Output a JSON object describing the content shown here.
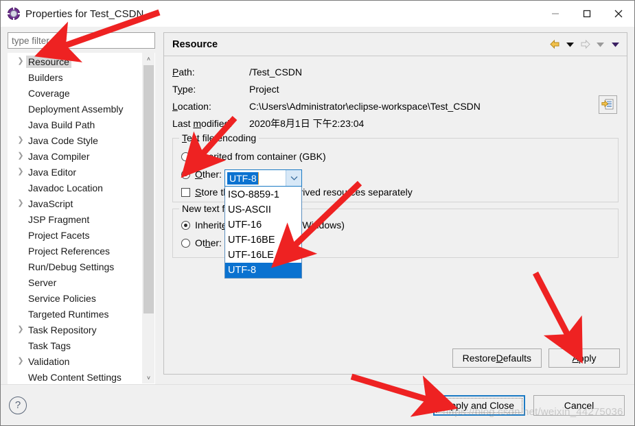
{
  "window": {
    "title": "Properties for Test_CSDN",
    "icon": "eclipse-properties-icon",
    "minimize_label": "—",
    "maximize_label": "□",
    "close_label": "✕"
  },
  "filter": {
    "placeholder": "type filter text",
    "value": ""
  },
  "tree": {
    "items": [
      {
        "label": "Resource",
        "expandable": true,
        "selected": true
      },
      {
        "label": "Builders",
        "expandable": false,
        "selected": false
      },
      {
        "label": "Coverage",
        "expandable": false,
        "selected": false
      },
      {
        "label": "Deployment Assembly",
        "expandable": false,
        "selected": false
      },
      {
        "label": "Java Build Path",
        "expandable": false,
        "selected": false
      },
      {
        "label": "Java Code Style",
        "expandable": true,
        "selected": false
      },
      {
        "label": "Java Compiler",
        "expandable": true,
        "selected": false
      },
      {
        "label": "Java Editor",
        "expandable": true,
        "selected": false
      },
      {
        "label": "Javadoc Location",
        "expandable": false,
        "selected": false
      },
      {
        "label": "JavaScript",
        "expandable": true,
        "selected": false
      },
      {
        "label": "JSP Fragment",
        "expandable": false,
        "selected": false
      },
      {
        "label": "Project Facets",
        "expandable": false,
        "selected": false
      },
      {
        "label": "Project References",
        "expandable": false,
        "selected": false
      },
      {
        "label": "Run/Debug Settings",
        "expandable": false,
        "selected": false
      },
      {
        "label": "Server",
        "expandable": false,
        "selected": false
      },
      {
        "label": "Service Policies",
        "expandable": false,
        "selected": false
      },
      {
        "label": "Targeted Runtimes",
        "expandable": false,
        "selected": false
      },
      {
        "label": "Task Repository",
        "expandable": true,
        "selected": false
      },
      {
        "label": "Task Tags",
        "expandable": false,
        "selected": false
      },
      {
        "label": "Validation",
        "expandable": true,
        "selected": false
      },
      {
        "label": "Web Content Settings",
        "expandable": false,
        "selected": false
      }
    ],
    "scroll_up_glyph": "˄",
    "scroll_down_glyph": "˅"
  },
  "pane": {
    "title": "Resource",
    "nav": {
      "back_icon": "back-arrow-icon",
      "back_menu_icon": "chevron-down-icon",
      "forward_icon": "forward-arrow-icon",
      "forward_menu_icon": "chevron-down-icon",
      "view_menu_icon": "chevron-down-icon"
    }
  },
  "properties": {
    "path_label": "Path:",
    "path_mnemonic": "P",
    "path_value": "/Test_CSDN",
    "type_label": "Type:",
    "type_mnemonic": "y",
    "type_value": "Project",
    "location_label": "Location:",
    "location_mnemonic": "L",
    "location_value": "C:\\Users\\Administrator\\eclipse-workspace\\Test_CSDN",
    "location_button_icon": "browse-folder-icon",
    "modified_label_pre": "Last ",
    "modified_mnemonic": "m",
    "modified_label_post": "odified:",
    "modified_value": "2020年8月1日 下午2:23:04"
  },
  "encoding_group": {
    "legend_pre": "T",
    "legend_post": "ext file encoding",
    "inherited_pre": "I",
    "inherited_post": "nherited from container (GBK)",
    "inherited_selected": false,
    "other_pre": "O",
    "other_post": "ther:",
    "other_selected": true,
    "store_pre": "S",
    "store_post": "tore the encoding of derived resources separately",
    "store_checked": false
  },
  "combo": {
    "value": "UTF-8",
    "arrow_icon": "chevron-down-icon",
    "open": true,
    "options": [
      {
        "label": "ISO-8859-1",
        "selected": false
      },
      {
        "label": "US-ASCII",
        "selected": false
      },
      {
        "label": "UTF-16",
        "selected": false
      },
      {
        "label": "UTF-16BE",
        "selected": false
      },
      {
        "label": "UTF-16LE",
        "selected": false
      },
      {
        "label": "UTF-8",
        "selected": true
      }
    ]
  },
  "delimiter_group": {
    "legend_pre": "New text f",
    "legend_mnemonic": "i",
    "legend_post": "le line delimiter",
    "inherited_pre": "Inherit",
    "inherited_mnemonic": "e",
    "inherited_post": "d from container (Windows)",
    "inherited_selected": true,
    "other_pre": "Ot",
    "other_mnemonic": "h",
    "other_post": "er:",
    "other_selected": false
  },
  "buttons": {
    "restore_defaults_pre": "Restore ",
    "restore_defaults_mnemonic": "D",
    "restore_defaults_post": "efaults",
    "apply_pre": "A",
    "apply_mnemonic": "",
    "apply_post": "pply",
    "apply_and_close": "Apply and Close",
    "cancel": "Cancel",
    "help_icon": "help-question-icon",
    "help_glyph": "?"
  },
  "watermark": {
    "text": "https://blog.csdn.net/weixin_44275036"
  },
  "colors": {
    "accent_blue": "#0b72d0",
    "focus_border": "#1b7ac4",
    "window_bg": "#f0f0f0",
    "annotation_red": "#ee2222",
    "selection_gray": "#d8d8d8"
  },
  "annotations": {
    "count": 5,
    "color": "#ee2222",
    "targets": [
      "resource-tree-item",
      "other-encoding-radio",
      "combo-utf8-selected-option",
      "apply-button",
      "apply-and-close-button"
    ]
  }
}
